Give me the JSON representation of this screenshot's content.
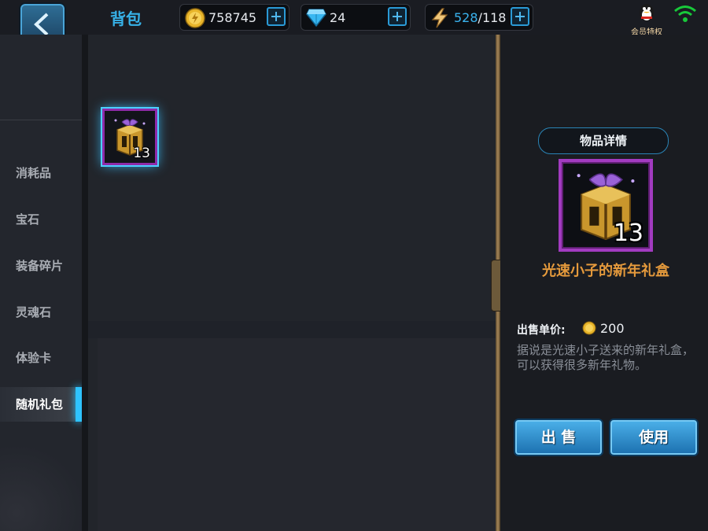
{
  "header": {
    "title": "背包",
    "gold": "758745",
    "gems": "24",
    "energy_current": "528",
    "energy_sep_max": "/118",
    "vip_label": "会员特权"
  },
  "sidebar": {
    "items": [
      {
        "label": "消耗品"
      },
      {
        "label": "宝石"
      },
      {
        "label": "装备碎片"
      },
      {
        "label": "灵魂石"
      },
      {
        "label": "体验卡"
      },
      {
        "label": "随机礼包"
      }
    ],
    "active_index": 5
  },
  "inventory": {
    "items": [
      {
        "icon": "gift-box-icon",
        "count": "13"
      }
    ]
  },
  "detail": {
    "header": "物品详情",
    "icon": "gift-box-icon",
    "count": "13",
    "name": "光速小子的新年礼盒",
    "price_label": "出售单价:",
    "price_value": "200",
    "description": "据说是光速小子送来的新年礼盒，可以获得很多新年礼物。",
    "sell_label": "出 售",
    "use_label": "使用"
  },
  "colors": {
    "accent": "#37b2e8",
    "item_name": "#e59a3c",
    "rarity_border": "#a23bc0"
  }
}
